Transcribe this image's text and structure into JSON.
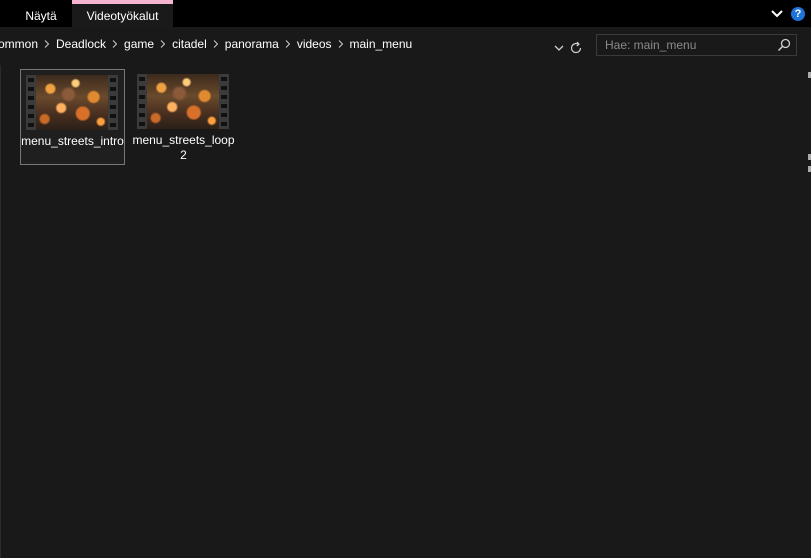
{
  "ribbon": {
    "tabs": [
      {
        "label": "Näytä"
      },
      {
        "label": "Videotyökalut"
      }
    ],
    "tools_tab_accent": "#f5b5d1",
    "help_glyph": "?"
  },
  "address": {
    "crumbs": [
      "ommon",
      "Deadlock",
      "game",
      "citadel",
      "panorama",
      "videos",
      "main_menu"
    ]
  },
  "search": {
    "placeholder": "Hae: main_menu"
  },
  "files": [
    {
      "name": "menu_streets_intro",
      "selected": true
    },
    {
      "name": "menu_streets_loop2",
      "selected": false
    }
  ]
}
